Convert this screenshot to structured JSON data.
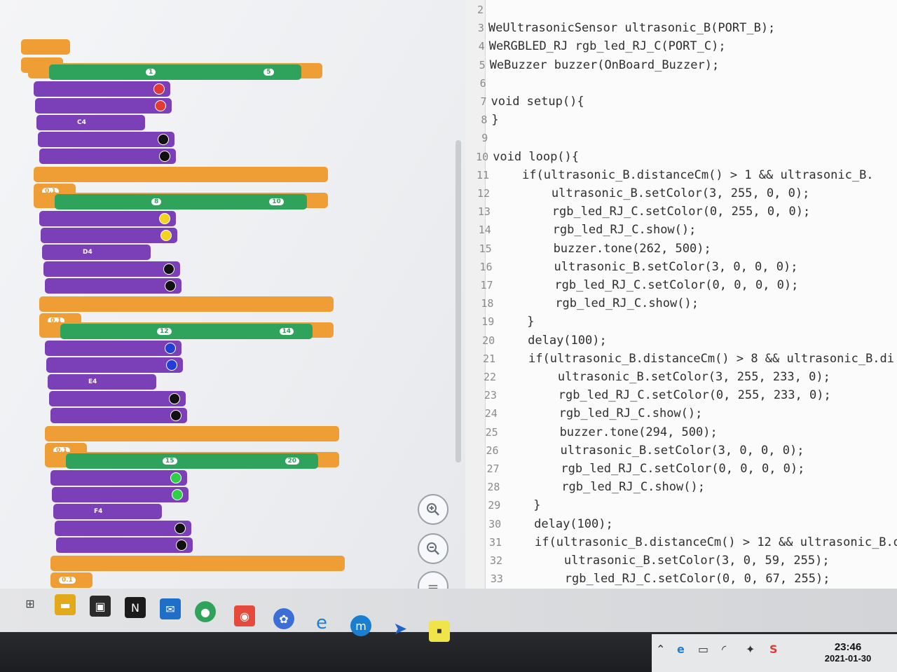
{
  "code_editor": {
    "lines": [
      {
        "num": "2",
        "text": ""
      },
      {
        "num": "3",
        "text": "WeUltrasonicSensor ultrasonic_B(PORT_B);"
      },
      {
        "num": "4",
        "text": "WeRGBLED_RJ rgb_led_RJ_C(PORT_C);"
      },
      {
        "num": "5",
        "text": "WeBuzzer buzzer(OnBoard_Buzzer);"
      },
      {
        "num": "6",
        "text": ""
      },
      {
        "num": "7",
        "text": "void setup(){"
      },
      {
        "num": "8",
        "text": "}"
      },
      {
        "num": "9",
        "text": ""
      },
      {
        "num": "10",
        "text": "void loop(){"
      },
      {
        "num": "11",
        "text": "    if(ultrasonic_B.distanceCm() > 1 && ultrasonic_B."
      },
      {
        "num": "12",
        "text": "        ultrasonic_B.setColor(3, 255, 0, 0);"
      },
      {
        "num": "13",
        "text": "        rgb_led_RJ_C.setColor(0, 255, 0, 0);"
      },
      {
        "num": "14",
        "text": "        rgb_led_RJ_C.show();"
      },
      {
        "num": "15",
        "text": "        buzzer.tone(262, 500);"
      },
      {
        "num": "16",
        "text": "        ultrasonic_B.setColor(3, 0, 0, 0);"
      },
      {
        "num": "17",
        "text": "        rgb_led_RJ_C.setColor(0, 0, 0, 0);"
      },
      {
        "num": "18",
        "text": "        rgb_led_RJ_C.show();"
      },
      {
        "num": "19",
        "text": "    }"
      },
      {
        "num": "20",
        "text": "    delay(100);"
      },
      {
        "num": "21",
        "text": "    if(ultrasonic_B.distanceCm() > 8 && ultrasonic_B.di"
      },
      {
        "num": "22",
        "text": "        ultrasonic_B.setColor(3, 255, 233, 0);"
      },
      {
        "num": "23",
        "text": "        rgb_led_RJ_C.setColor(0, 255, 233, 0);"
      },
      {
        "num": "24",
        "text": "        rgb_led_RJ_C.show();"
      },
      {
        "num": "25",
        "text": "        buzzer.tone(294, 500);"
      },
      {
        "num": "26",
        "text": "        ultrasonic_B.setColor(3, 0, 0, 0);"
      },
      {
        "num": "27",
        "text": "        rgb_led_RJ_C.setColor(0, 0, 0, 0);"
      },
      {
        "num": "28",
        "text": "        rgb_led_RJ_C.show();"
      },
      {
        "num": "29",
        "text": "    }"
      },
      {
        "num": "30",
        "text": "    delay(100);"
      },
      {
        "num": "31",
        "text": "    if(ultrasonic_B.distanceCm() > 12 && ultrasonic_B.di"
      },
      {
        "num": "32",
        "text": "        ultrasonic_B.setColor(3, 0, 59, 255);"
      },
      {
        "num": "33",
        "text": "        rgb_led_RJ_C.setColor(0, 0, 67, 255);"
      }
    ]
  },
  "blocks": {
    "groups": [
      {
        "cond_a": "1",
        "cond_b": "5",
        "color": "#e53935",
        "note": "C4",
        "wait": "0.1"
      },
      {
        "cond_a": "8",
        "cond_b": "10",
        "color": "#f4d21f",
        "note": "D4",
        "wait": "0.1"
      },
      {
        "cond_a": "12",
        "cond_b": "14",
        "color": "#1f3fd8",
        "note": "E4",
        "wait": "0.1"
      },
      {
        "cond_a": "15",
        "cond_b": "20",
        "color": "#2fcf4a",
        "note": "F4",
        "wait": "0.1"
      }
    ]
  },
  "zoom": {
    "in_icon": "zoom-in-icon",
    "out_icon": "zoom-out-icon",
    "reset_icon": "reset-icon",
    "reset_glyph": "="
  },
  "clock": {
    "time": "23:46",
    "date": "2021-01-30"
  }
}
